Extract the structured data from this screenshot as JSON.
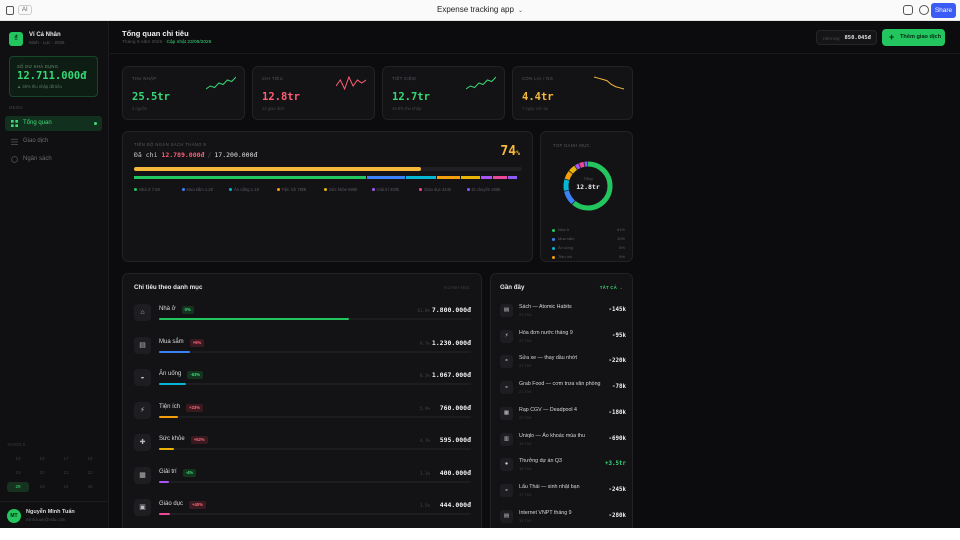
{
  "browser": {
    "badge": "AI",
    "title": "Expense tracking app",
    "share_label": "Share"
  },
  "brand": {
    "logo_letter": "₫",
    "name": "Ví Cá Nhân",
    "sub": "Minh · Lực · 2026"
  },
  "balance": {
    "label": "SỐ DƯ KHẢ DỤNG",
    "value": "12.711.000đ",
    "note": "▲ 35% thu nhập đã tiêu"
  },
  "nav": {
    "section": "MENU",
    "items": [
      {
        "label": "Tổng quan",
        "icon": "grid-icon"
      },
      {
        "label": "Giao dịch",
        "icon": "list-icon"
      },
      {
        "label": "Ngân sách",
        "icon": "pie-icon"
      }
    ]
  },
  "calendar": {
    "head": "THÁNG 9",
    "cells": [
      "15",
      "16",
      "17",
      "18",
      "19",
      "20",
      "21",
      "22",
      "23",
      "24",
      "25",
      "26"
    ],
    "selected": "29"
  },
  "user": {
    "initials": "MT",
    "name": "Nguyễn Minh Tuấn",
    "email": "minh.tuan@vidu.com"
  },
  "header": {
    "title": "Tổng quan chi tiêu",
    "subtitle_prefix": "Tháng 9 năm 2026 ·",
    "updated": "Cập nhật 23/09/2026",
    "today_label": "Hôm nay",
    "today_value": "850.045đ",
    "add_button": "Thêm giao dịch"
  },
  "stats": [
    {
      "label": "THU NHẬP",
      "value": "25.5tr",
      "note": "3 nguồn",
      "color": "#36d875",
      "spark_color": "#36d875",
      "trend": [
        3,
        4,
        3.5,
        5,
        4.5,
        6,
        5.5,
        7
      ]
    },
    {
      "label": "CHI TIÊU",
      "value": "12.8tr",
      "note": "22 giao dịch",
      "color": "#ff5d73",
      "spark_color": "#ff5d73",
      "trend": [
        4,
        6,
        3,
        7,
        4,
        6,
        5,
        6
      ]
    },
    {
      "label": "TIẾT KIỆM",
      "value": "12.7tr",
      "note": "49.8% thu nhập",
      "color": "#36d875",
      "spark_color": "#36d875",
      "trend": [
        2,
        3,
        2.5,
        4,
        3.5,
        5,
        4.5,
        6
      ]
    },
    {
      "label": "CÒN LẠI / NG",
      "value": "4.4tr",
      "note": "7 ngày còn lại",
      "color": "#f5b83d",
      "spark_color": "#f5b83d",
      "trend": [
        7,
        6.5,
        6,
        5.5,
        4,
        3,
        2.5,
        2
      ]
    }
  ],
  "budget": {
    "label": "TIẾN ĐỘ NGÂN SÁCH THÁNG 9",
    "spent_prefix": "Đã chi",
    "spent": "12.789.000đ",
    "sep": "/",
    "total": "17.200.000đ",
    "percent": "74",
    "percent_sign": "%",
    "progress": 0.74,
    "segments": [
      {
        "name": "Nhà ở",
        "amount": "7.8tr",
        "share": 0.61,
        "color": "#22c55e"
      },
      {
        "name": "Mua sắm",
        "amount": "1.2tr",
        "share": 0.1,
        "color": "#3b82f6"
      },
      {
        "name": "Ăn uống",
        "amount": "1.1tr",
        "share": 0.08,
        "color": "#06b6d4"
      },
      {
        "name": "Tiện ích",
        "amount": "760k",
        "share": 0.06,
        "color": "#f59e0b"
      },
      {
        "name": "Sức khỏe",
        "amount": "595k",
        "share": 0.05,
        "color": "#eab308"
      },
      {
        "name": "Giải trí",
        "amount": "400k",
        "share": 0.03,
        "color": "#a855f7"
      },
      {
        "name": "Giáo dục",
        "amount": "444k",
        "share": 0.035,
        "color": "#ec4899"
      },
      {
        "name": "Di chuyển",
        "amount": "305k",
        "share": 0.025,
        "color": "#8b5cf6"
      }
    ]
  },
  "top_categories": {
    "label": "TOP DANH MỤC",
    "center_label": "Tổng",
    "center_value": "12.8tr",
    "rows": [
      {
        "name": "Nhà ở",
        "pct": "61%",
        "color": "#22c55e"
      },
      {
        "name": "Mua sắm",
        "pct": "10%",
        "color": "#3b82f6"
      },
      {
        "name": "Ăn uống",
        "pct": "8%",
        "color": "#06b6d4"
      },
      {
        "name": "Tiện ích",
        "pct": "6%",
        "color": "#f59e0b"
      }
    ]
  },
  "categories": {
    "title": "Chi tiêu theo danh mục",
    "right_note": "8 DANH MỤC",
    "rows": [
      {
        "icon": "home-icon",
        "glyph": "⌂",
        "name": "Nhà ở",
        "badge": "0%",
        "dir": "down",
        "pct": "61.0%",
        "amount": "7.800.000đ",
        "fill": 0.61,
        "color": "#22c55e"
      },
      {
        "icon": "shopping-icon",
        "glyph": "▤",
        "name": "Mua sắm",
        "badge": "+5%",
        "dir": "up",
        "pct": "9.7%",
        "amount": "1.230.000đ",
        "fill": 0.1,
        "color": "#3b82f6"
      },
      {
        "icon": "food-icon",
        "glyph": "◒",
        "name": "Ăn uống",
        "badge": "-63%",
        "dir": "down",
        "pct": "8.3%",
        "amount": "1.067.000đ",
        "fill": 0.085,
        "color": "#06b6d4"
      },
      {
        "icon": "utility-icon",
        "glyph": "⚡",
        "name": "Tiện ích",
        "badge": "+23%",
        "dir": "up",
        "pct": "5.9%",
        "amount": "760.000đ",
        "fill": 0.06,
        "color": "#f59e0b"
      },
      {
        "icon": "health-icon",
        "glyph": "✚",
        "name": "Sức khỏe",
        "badge": "+52%",
        "dir": "up",
        "pct": "4.7%",
        "amount": "595.000đ",
        "fill": 0.047,
        "color": "#eab308"
      },
      {
        "icon": "entertainment-icon",
        "glyph": "▦",
        "name": "Giải trí",
        "badge": "-4%",
        "dir": "down",
        "pct": "3.1%",
        "amount": "400.000đ",
        "fill": 0.031,
        "color": "#a855f7"
      },
      {
        "icon": "education-icon",
        "glyph": "▣",
        "name": "Giáo dục",
        "badge": "+40%",
        "dir": "up",
        "pct": "3.5%",
        "amount": "444.000đ",
        "fill": 0.035,
        "color": "#ec4899"
      }
    ]
  },
  "recent": {
    "title": "Gần đây",
    "see_all": "TẤT CẢ →",
    "items": [
      {
        "icon": "book-icon",
        "glyph": "▤",
        "name": "Sách — Atomic Habits",
        "date": "23 Th9",
        "amount": "-145k",
        "positive": false
      },
      {
        "icon": "bolt-icon",
        "glyph": "⚡",
        "name": "Hóa đơn nước tháng 9",
        "date": "22 Th9",
        "amount": "-95k",
        "positive": false
      },
      {
        "icon": "bike-icon",
        "glyph": "◓",
        "name": "Sửa xe — thay dầu nhớt",
        "date": "21 Th9",
        "amount": "-220k",
        "positive": false
      },
      {
        "icon": "food-icon",
        "glyph": "◒",
        "name": "Grab Food — cơm trưa văn phòng",
        "date": "21 Th9",
        "amount": "-78k",
        "positive": false
      },
      {
        "icon": "movie-icon",
        "glyph": "▦",
        "name": "Rạp CGV — Deadpool 4",
        "date": "20 Th9",
        "amount": "-180k",
        "positive": false
      },
      {
        "icon": "shirt-icon",
        "glyph": "▥",
        "name": "Uniqlo — Áo khoác mùa thu",
        "date": "19 Th9",
        "amount": "-690k",
        "positive": false
      },
      {
        "icon": "money-icon",
        "glyph": "●",
        "name": "Thưởng dự án Q3",
        "date": "18 Th9",
        "amount": "+3.5tr",
        "positive": true
      },
      {
        "icon": "hotpot-icon",
        "glyph": "◒",
        "name": "Lẩu Thái — sinh nhật bạn",
        "date": "17 Th9",
        "amount": "-245k",
        "positive": false
      },
      {
        "icon": "wifi-icon",
        "glyph": "▤",
        "name": "Internet VNPT tháng 9",
        "date": "15 Th9",
        "amount": "-280k",
        "positive": false
      }
    ]
  }
}
